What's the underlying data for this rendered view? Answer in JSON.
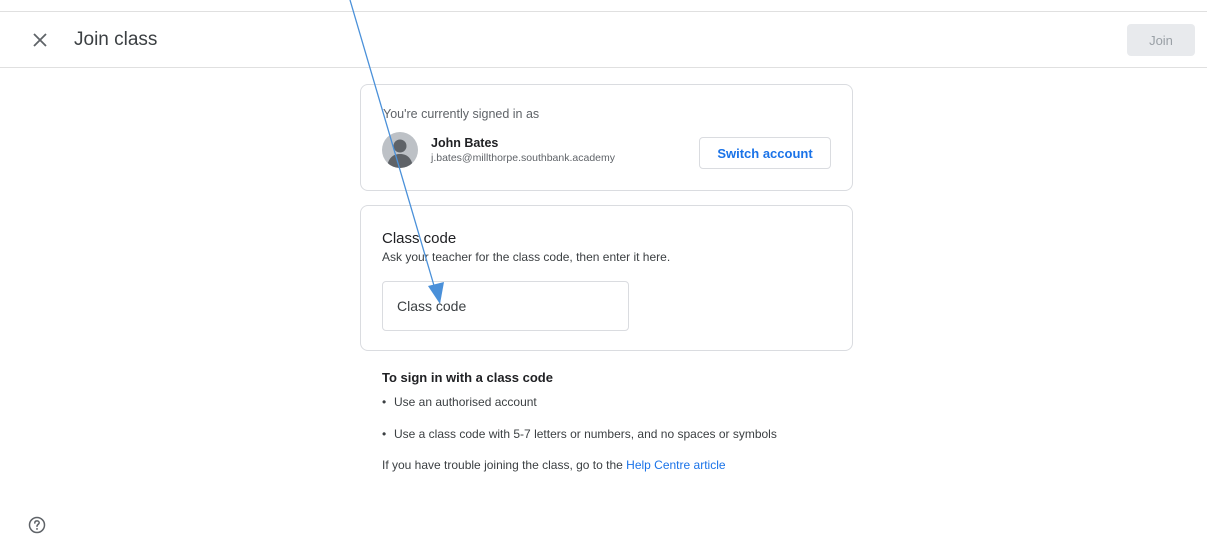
{
  "header": {
    "title": "Join class",
    "close_icon": "close-icon",
    "join_label": "Join"
  },
  "account": {
    "signed_in_label": "You're currently signed in as",
    "name": "John Bates",
    "email": "j.bates@millthorpe.southbank.academy",
    "switch_label": "Switch account",
    "avatar_icon": "avatar-icon"
  },
  "class_code": {
    "title": "Class code",
    "description": "Ask your teacher for the class code, then enter it here.",
    "placeholder": "Class code",
    "value": ""
  },
  "info": {
    "title": "To sign in with a class code",
    "bullets": [
      "Use an authorised account",
      "Use a class code with 5-7 letters or numbers, and no spaces or symbols"
    ],
    "trouble_prefix": "If you have trouble joining the class, go to the ",
    "help_link": "Help Centre article"
  },
  "footer": {
    "help_icon": "help-circle-icon"
  },
  "colors": {
    "accent": "#1a73e8",
    "border": "#dadce0",
    "annotation_arrow": "#4a90d9",
    "disabled_button_bg": "#e8eaed"
  }
}
